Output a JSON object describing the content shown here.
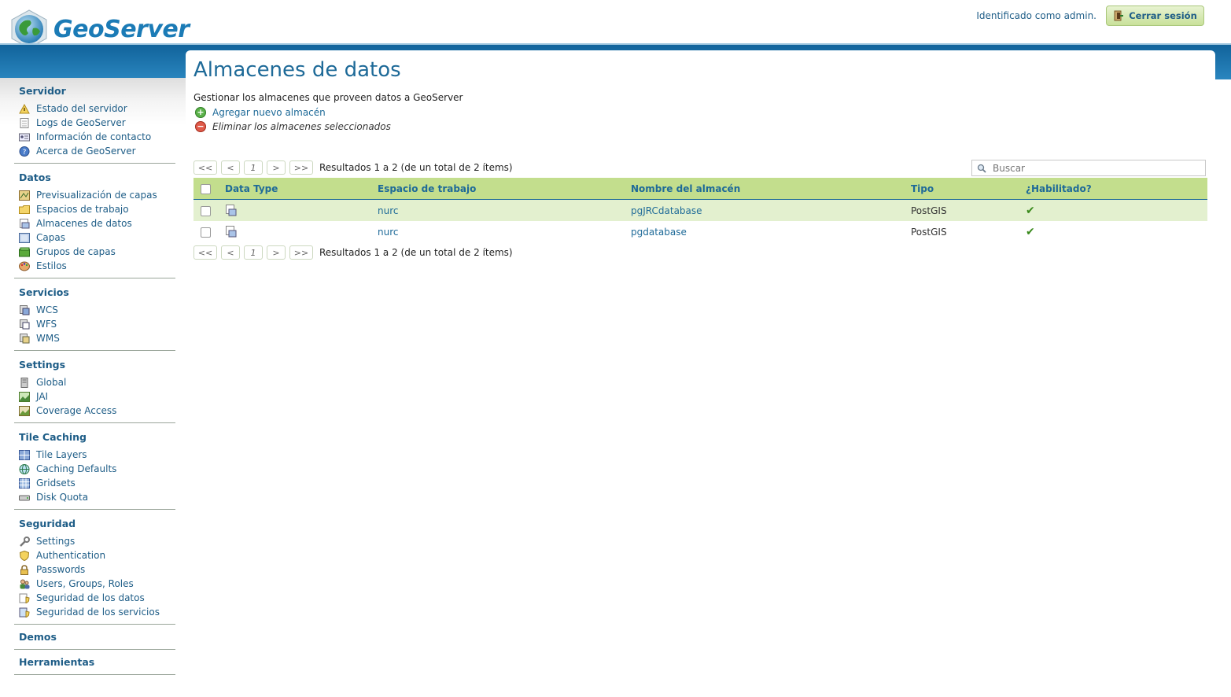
{
  "app": {
    "name": "GeoServer"
  },
  "header": {
    "login_status": "Identificado como admin.",
    "logout_label": "Cerrar sesión"
  },
  "sidebar": {
    "sections": [
      {
        "title": "Servidor",
        "items": [
          "Estado del servidor",
          "Logs de GeoServer",
          "Información de contacto",
          "Acerca de GeoServer"
        ]
      },
      {
        "title": "Datos",
        "items": [
          "Previsualización de capas",
          "Espacios de trabajo",
          "Almacenes de datos",
          "Capas",
          "Grupos de capas",
          "Estilos"
        ]
      },
      {
        "title": "Servicios",
        "items": [
          "WCS",
          "WFS",
          "WMS"
        ]
      },
      {
        "title": "Settings",
        "items": [
          "Global",
          "JAI",
          "Coverage Access"
        ]
      },
      {
        "title": "Tile Caching",
        "items": [
          "Tile Layers",
          "Caching Defaults",
          "Gridsets",
          "Disk Quota"
        ]
      },
      {
        "title": "Seguridad",
        "items": [
          "Settings",
          "Authentication",
          "Passwords",
          "Users, Groups, Roles",
          "Seguridad de los datos",
          "Seguridad de los servicios"
        ]
      },
      {
        "title": "Demos",
        "items": []
      },
      {
        "title": "Herramientas",
        "items": []
      }
    ]
  },
  "main": {
    "title": "Almacenes de datos",
    "description": "Gestionar los almacenes que proveen datos a GeoServer",
    "add_label": "Agregar nuevo almacén",
    "remove_label": "Eliminar los almacenes seleccionados",
    "pager": {
      "first": "<<",
      "prev": "<",
      "page": "1",
      "next": ">",
      "last": ">>",
      "results": "Resultados 1 a 2 (de un total de 2 ítems)"
    },
    "search_placeholder": "Buscar",
    "columns": [
      "Data Type",
      "Espacio de trabajo",
      "Nombre del almacén",
      "Tipo",
      "¿Habilitado?"
    ],
    "rows": [
      {
        "workspace": "nurc",
        "store": "pgJRCdatabase",
        "type": "PostGIS",
        "enabled": "✔"
      },
      {
        "workspace": "nurc",
        "store": "pgdatabase",
        "type": "PostGIS",
        "enabled": "✔"
      }
    ]
  },
  "colors": {
    "accent": "#1e6a98",
    "header_band": "#11639b",
    "table_header": "#c3de8d",
    "row_highlight": "#e3f0cf",
    "check": "#3a8a1c"
  }
}
